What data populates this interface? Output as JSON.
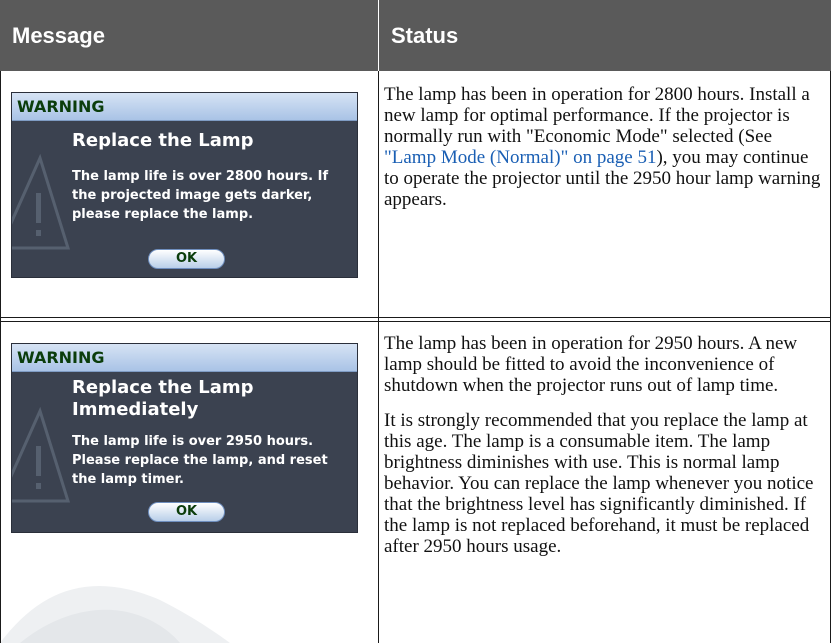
{
  "header": {
    "message": "Message",
    "status": "Status"
  },
  "rows": [
    {
      "dialog": {
        "title": "WARNING",
        "heading": "Replace the Lamp",
        "body": "The lamp life is over 2800 hours. If the projected image gets darker, please replace the lamp.",
        "ok_label": "OK"
      },
      "status": {
        "text_before_link": "The lamp has been in operation for 2800 hours. Install a new lamp for optimal performance. If the projector is normally run with \"Economic Mode\" selected (See ",
        "link": "\"Lamp Mode (Normal)\" on page 51",
        "text_after_link": "), you may continue to operate the projector until the 2950 hour lamp warning appears."
      }
    },
    {
      "dialog": {
        "title": "WARNING",
        "heading": "Replace the Lamp Immediately",
        "body": "The lamp life is over 2950 hours. Please replace the lamp, and reset the lamp timer.",
        "ok_label": "OK"
      },
      "status": {
        "paragraph1": "The lamp has been in operation for 2950 hours. A new lamp should be fitted to avoid the inconvenience of shutdown when the projector runs out of lamp time.",
        "paragraph2": "It is strongly recommended that you replace the lamp at this age. The lamp is a consumable item. The lamp brightness diminishes with use. This is normal lamp behavior. You can replace the lamp whenever you notice that the brightness level has significantly diminished. If the lamp is not replaced beforehand, it must be replaced after 2950 hours usage."
      }
    }
  ]
}
